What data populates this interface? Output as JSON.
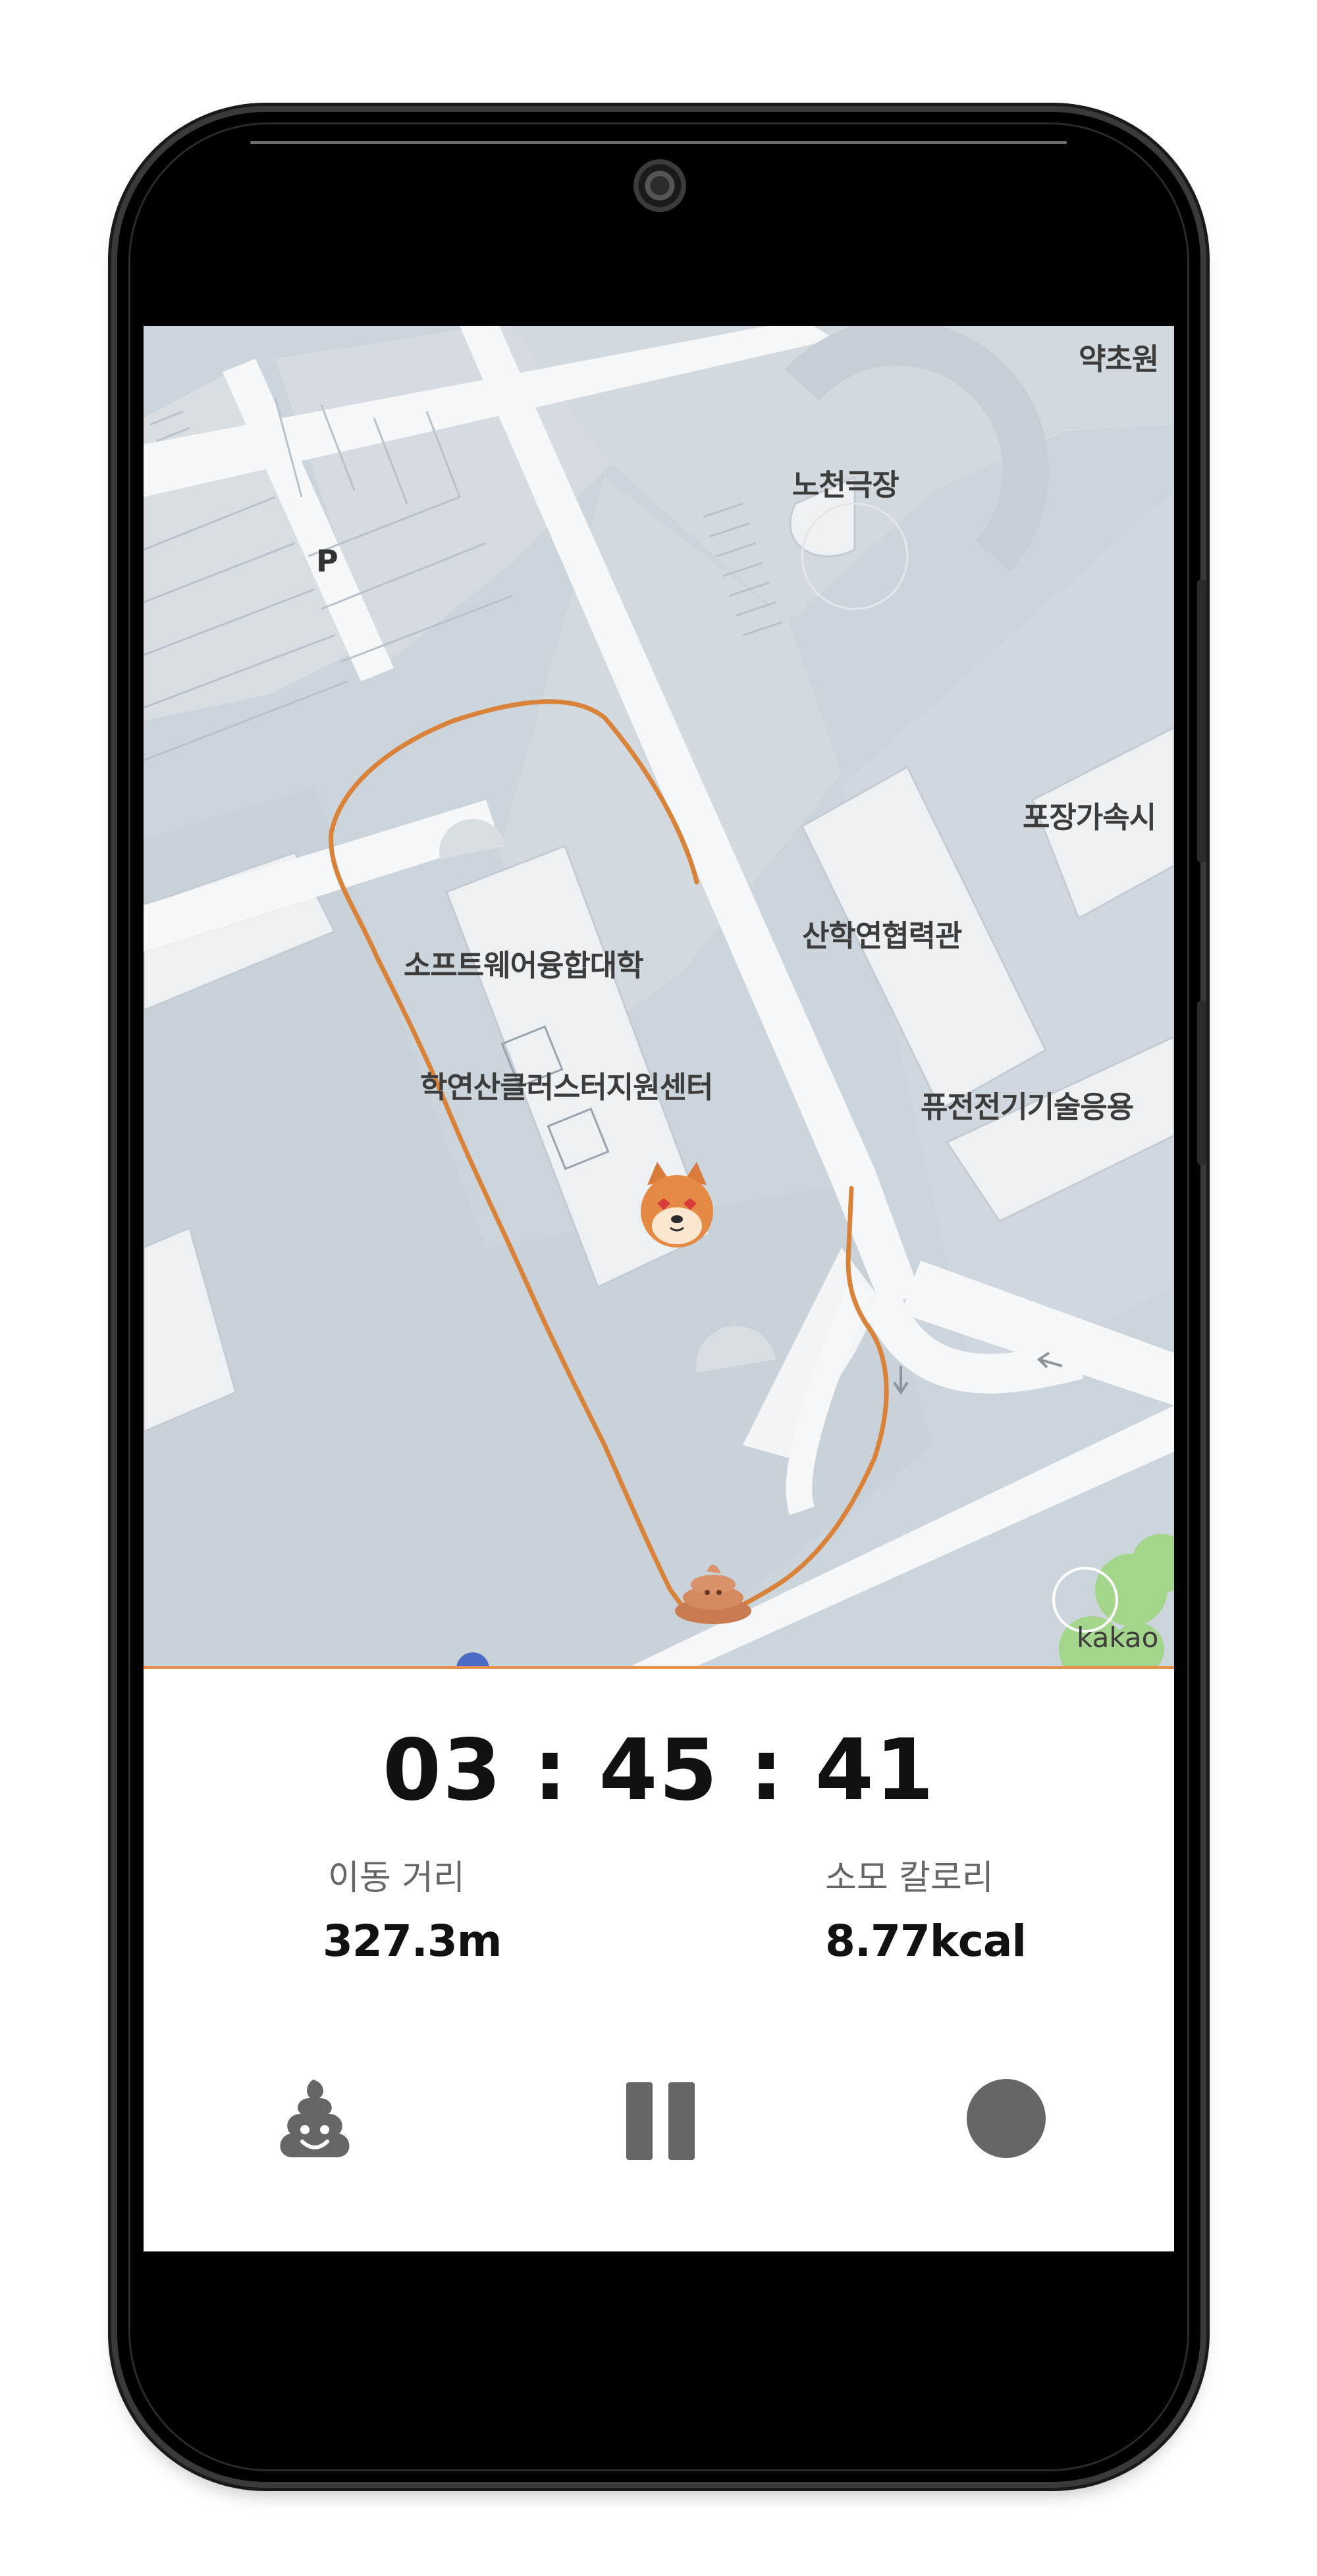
{
  "map": {
    "labels": {
      "yakchowon": "약초원",
      "nocheon_theater": "노천극장",
      "packaging_center": "포장가속시",
      "industry_academic": "산학연협력관",
      "software": "소프트웨어융합대학",
      "cluster_center": "학연산클러스터지원센터",
      "fusion_tech": "퓨전전기기술응용",
      "parking": "P"
    },
    "logo": "kakao",
    "route_color": "#d9823a"
  },
  "workout": {
    "timer": "03 : 45 : 41",
    "distance_label": "이동 거리",
    "distance_value": "327.3m",
    "calorie_label": "소모 칼로리",
    "calorie_value": "8.77kcal"
  },
  "controls": {
    "poop_button_icon": "poop-icon",
    "pause_button_icon": "pause-icon",
    "stop_button_icon": "stop-circle-icon",
    "icon_color": "#666666"
  }
}
